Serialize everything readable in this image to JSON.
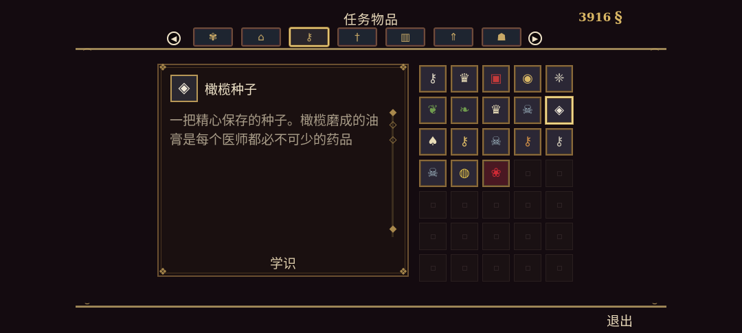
{
  "header": {
    "title": "任务物品",
    "currency": {
      "amount": "3916",
      "icon": "tear-currency-icon"
    }
  },
  "tabs": [
    {
      "icon": "relics-tab-icon",
      "glyph": "✾",
      "active": false
    },
    {
      "icon": "altar-tab-icon",
      "glyph": "⌂",
      "active": false
    },
    {
      "icon": "key-tab-icon",
      "glyph": "⚷",
      "active": true
    },
    {
      "icon": "sword-tab-icon",
      "glyph": "†",
      "active": false
    },
    {
      "icon": "book-tab-icon",
      "glyph": "▥",
      "active": false
    },
    {
      "icon": "prayer-tab-icon",
      "glyph": "⇑",
      "active": false
    },
    {
      "icon": "collectibles-tab-icon",
      "glyph": "☗",
      "active": false
    }
  ],
  "selected_item": {
    "name": "橄榄种子",
    "description": "一把精心保存的种子。橄榄磨成的油膏是每个医师都必不可少的药品",
    "category": "学识",
    "icon": "olive-seed-icon"
  },
  "inventory": {
    "items": [
      {
        "icon": "ornate-key-icon",
        "glyph": "⚷",
        "color": "#d9d2c0"
      },
      {
        "icon": "crowned-egg-icon",
        "glyph": "♛",
        "color": "#e8dcb8"
      },
      {
        "icon": "red-cloth-icon",
        "glyph": "▣",
        "color": "#c23a3a"
      },
      {
        "icon": "orb-relic-icon",
        "glyph": "◉",
        "color": "#d9b765"
      },
      {
        "icon": "crystal-cluster-icon",
        "glyph": "❈",
        "color": "#c9c3b3"
      },
      {
        "icon": "herb-sprig-icon",
        "glyph": "❦",
        "color": "#6f9a4e"
      },
      {
        "icon": "herb-leaf-icon",
        "glyph": "❧",
        "color": "#6f9a4e"
      },
      {
        "icon": "crowned-chalice-icon",
        "glyph": "♛",
        "color": "#e8dcb8"
      },
      {
        "icon": "skull-jar-icon",
        "glyph": "☠",
        "color": "#9fb6c2"
      },
      {
        "icon": "olive-seed-icon",
        "glyph": "◈",
        "color": "#efe8d8",
        "selected": true
      },
      {
        "icon": "bulb-relic-icon",
        "glyph": "♠",
        "color": "#e8dcb8"
      },
      {
        "icon": "golden-key-icon",
        "glyph": "⚷",
        "color": "#d9b765"
      },
      {
        "icon": "skull-jar-icon",
        "glyph": "☠",
        "color": "#9fb6c2"
      },
      {
        "icon": "bronze-key-icon",
        "glyph": "⚷",
        "color": "#c98a45"
      },
      {
        "icon": "silver-key-icon",
        "glyph": "⚷",
        "color": "#c9c3b3"
      },
      {
        "icon": "skull-jar-icon",
        "glyph": "☠",
        "color": "#9fb6c2"
      },
      {
        "icon": "gold-ring-icon",
        "glyph": "◍",
        "color": "#e0c04a"
      },
      {
        "icon": "red-rose-icon",
        "glyph": "❀",
        "color": "#d02a35",
        "red_bg": true
      }
    ],
    "columns": 5,
    "rows": 7
  },
  "footer": {
    "exit_label": "退出"
  },
  "colors": {
    "background": "#140b10",
    "gold_accent": "#d9b765",
    "frame": "#6b5030"
  }
}
